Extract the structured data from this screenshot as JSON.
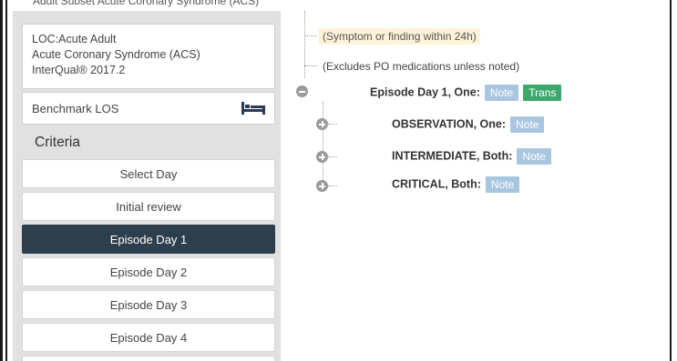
{
  "header": {
    "breadcrumb": "Adult   Subset  Acute Coronary Syndrome (ACS)"
  },
  "sidebar": {
    "info": {
      "line1": "LOC:Acute Adult",
      "line2": "Acute Coronary Syndrome (ACS)",
      "line3": "InterQual® 2017.2"
    },
    "benchmark_label": "Benchmark LOS",
    "criteria_heading": "Criteria",
    "days": [
      {
        "label": "Select Day",
        "active": false
      },
      {
        "label": "Initial review",
        "active": false
      },
      {
        "label": "Episode Day 1",
        "active": true
      },
      {
        "label": "Episode Day 2",
        "active": false
      },
      {
        "label": "Episode Day 3",
        "active": false
      },
      {
        "label": "Episode Day 4",
        "active": false
      }
    ]
  },
  "tree": {
    "note1": "(Symptom or finding within 24h)",
    "note2": "(Excludes PO medications unless noted)",
    "episode": {
      "label": "Episode Day 1, One:",
      "note": "Note",
      "trans": "Trans"
    },
    "children": [
      {
        "label": "OBSERVATION, One:",
        "note": "Note"
      },
      {
        "label": "INTERMEDIATE, Both:",
        "note": "Note"
      },
      {
        "label": "CRITICAL, Both:",
        "note": "Note"
      }
    ]
  },
  "colors": {
    "active_day": "#2d3e4d",
    "note_badge": "#a9c6e0",
    "trans_badge": "#3ba86c",
    "highlight": "#fcf3d9"
  }
}
